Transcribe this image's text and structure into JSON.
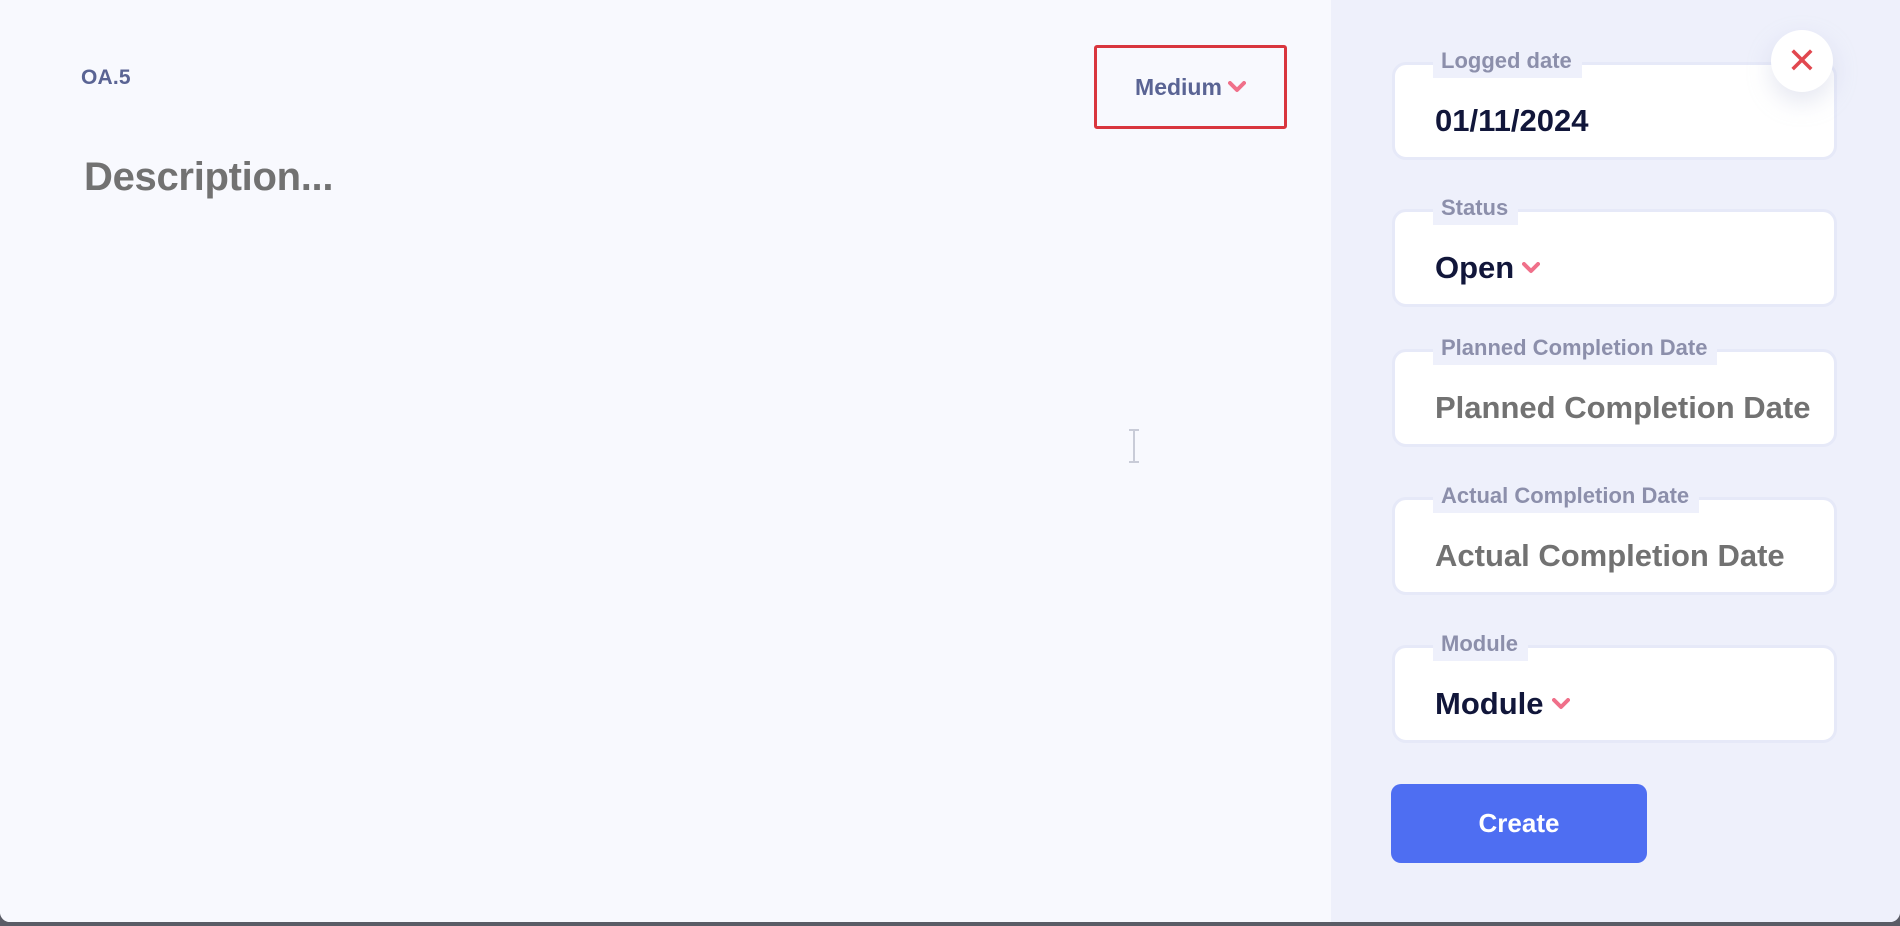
{
  "colors": {
    "accent": "#4e6ef2",
    "danger": "#e1474f",
    "chevron": "#f0708a",
    "text_dark": "#11163a",
    "text_muted": "#727272",
    "label": "#8c8fab"
  },
  "item": {
    "id": "OA.5",
    "priority": "Medium",
    "description_placeholder": "Description..."
  },
  "fields": {
    "logged_date": {
      "label": "Logged date",
      "value": "01/11/2024"
    },
    "status": {
      "label": "Status",
      "value": "Open"
    },
    "planned_completion": {
      "label": "Planned Completion Date",
      "placeholder": "Planned Completion Date"
    },
    "actual_completion": {
      "label": "Actual Completion Date",
      "placeholder": "Actual Completion Date"
    },
    "module": {
      "label": "Module",
      "value": "Module"
    }
  },
  "actions": {
    "create_label": "Create",
    "close_icon": "close-icon"
  }
}
